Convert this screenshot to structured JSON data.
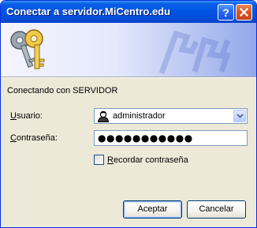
{
  "window": {
    "title": "Conectar a servidor.MiCentro.edu",
    "help_label": "?",
    "close_label": "×"
  },
  "dialog": {
    "connecting_text": "Conectando con SERVIDOR",
    "username": {
      "label_underlined": "U",
      "label_rest": "suario:",
      "value": "administrador"
    },
    "password": {
      "label_pre": "",
      "label_underlined": "C",
      "label_rest": "ontraseña:",
      "value": "●●●●●●●●●●●"
    },
    "remember": {
      "label_underlined": "R",
      "label_rest": "ecordar contraseña",
      "checked": false
    },
    "buttons": {
      "ok": "Aceptar",
      "cancel": "Cancelar"
    }
  },
  "icons": {
    "banner": "keys-icon",
    "user": "user-icon",
    "dropdown": "chevron-down-icon"
  },
  "colors": {
    "titlebar": "#0054e3",
    "window_bg": "#ece9d8",
    "close_button": "#d9531e"
  }
}
